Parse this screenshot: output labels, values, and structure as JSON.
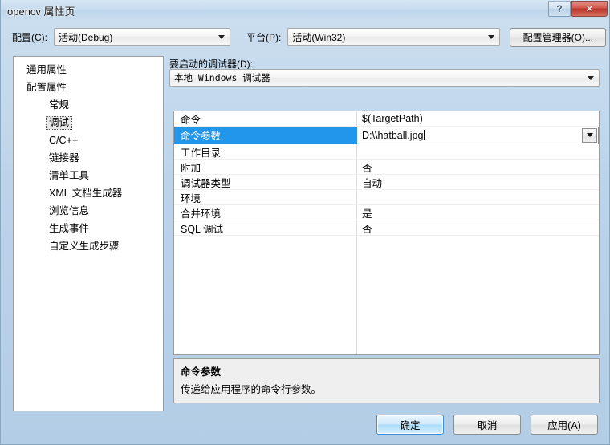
{
  "window": {
    "title": "opencv 属性页",
    "help_button": "?",
    "close_button": "✕"
  },
  "config_bar": {
    "config_label": "配置(C):",
    "config_value": "活动(Debug)",
    "platform_label": "平台(P):",
    "platform_value": "活动(Win32)",
    "config_manager_button": "配置管理器(O)..."
  },
  "tree": {
    "items": [
      {
        "label": "通用属性",
        "level": 0,
        "selected": false
      },
      {
        "label": "配置属性",
        "level": 0,
        "selected": false
      },
      {
        "label": "常规",
        "level": 1,
        "selected": false
      },
      {
        "label": "调试",
        "level": 1,
        "selected": true
      },
      {
        "label": "C/C++",
        "level": 1,
        "selected": false
      },
      {
        "label": "链接器",
        "level": 1,
        "selected": false
      },
      {
        "label": "清单工具",
        "level": 1,
        "selected": false
      },
      {
        "label": "XML 文档生成器",
        "level": 1,
        "selected": false
      },
      {
        "label": "浏览信息",
        "level": 1,
        "selected": false
      },
      {
        "label": "生成事件",
        "level": 1,
        "selected": false
      },
      {
        "label": "自定义生成步骤",
        "level": 1,
        "selected": false
      }
    ]
  },
  "debugger_select": {
    "label": "要启动的调试器(D):",
    "value": "本地 Windows 调试器"
  },
  "property_grid": {
    "rows": [
      {
        "name": "命令",
        "value": "$(TargetPath)",
        "selected": false
      },
      {
        "name": "命令参数",
        "value": "D:\\\\hatball.jpg",
        "selected": true,
        "editing": true
      },
      {
        "name": "工作目录",
        "value": "",
        "selected": false
      },
      {
        "name": "附加",
        "value": "否",
        "selected": false
      },
      {
        "name": "调试器类型",
        "value": "自动",
        "selected": false
      },
      {
        "name": "环境",
        "value": "",
        "selected": false
      },
      {
        "name": "合并环境",
        "value": "是",
        "selected": false
      },
      {
        "name": "SQL 调试",
        "value": "否",
        "selected": false
      }
    ]
  },
  "description": {
    "title": "命令参数",
    "body": "传递给应用程序的命令行参数。"
  },
  "buttons": {
    "ok": "确定",
    "cancel": "取消",
    "apply": "应用(A)"
  },
  "colors": {
    "selection_blue": "#2196ea",
    "titlebar_blue": "#bdd5ea",
    "close_red": "#b9362b",
    "default_button_blue": "#3c8ddd"
  }
}
